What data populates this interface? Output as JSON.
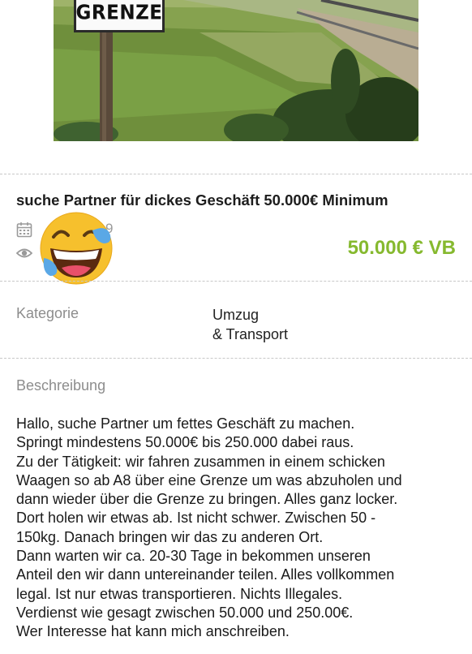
{
  "photo": {
    "sign_text": "GRENZE"
  },
  "listing": {
    "title": "suche Partner für dickes Geschäft 50.000€ Minimum",
    "date_visible": "9",
    "price": "50.000 € VB"
  },
  "icons": {
    "calendar": "calendar-icon",
    "views": "eye-icon",
    "overlay": "laughing-tears-emoji"
  },
  "details": {
    "kategorie_label": "Kategorie",
    "kategorie_value_line1": "Umzug",
    "kategorie_value_line2": "& Transport"
  },
  "beschreibung": {
    "label": "Beschreibung",
    "lines": [
      "Hallo, suche Partner um fettes Geschäft zu machen.",
      "Springt mindestens 50.000€ bis 250.000 dabei raus.",
      "Zu der Tätigkeit: wir fahren zusammen in einem schicken",
      "Waagen so ab A8 über eine Grenze um was abzuholen und",
      "dann wieder über die Grenze zu bringen. Alles ganz locker.",
      "Dort holen wir etwas ab. Ist nicht schwer. Zwischen 50 -",
      "150kg. Danach bringen wir das zu anderen Ort.",
      "Dann warten wir ca. 20-30 Tage in bekommen unseren",
      "Anteil den wir dann untereinander teilen. Alles vollkommen",
      "legal. Ist nur etwas transportieren. Nichts Illegales.",
      "Verdienst wie gesagt zwischen 50.000 und 250.00€.",
      "Wer Interesse hat kann mich anschreiben."
    ]
  },
  "colors": {
    "price": "#86b92f",
    "label_gray": "#8d8d8d",
    "divider": "#c8c8c8"
  }
}
